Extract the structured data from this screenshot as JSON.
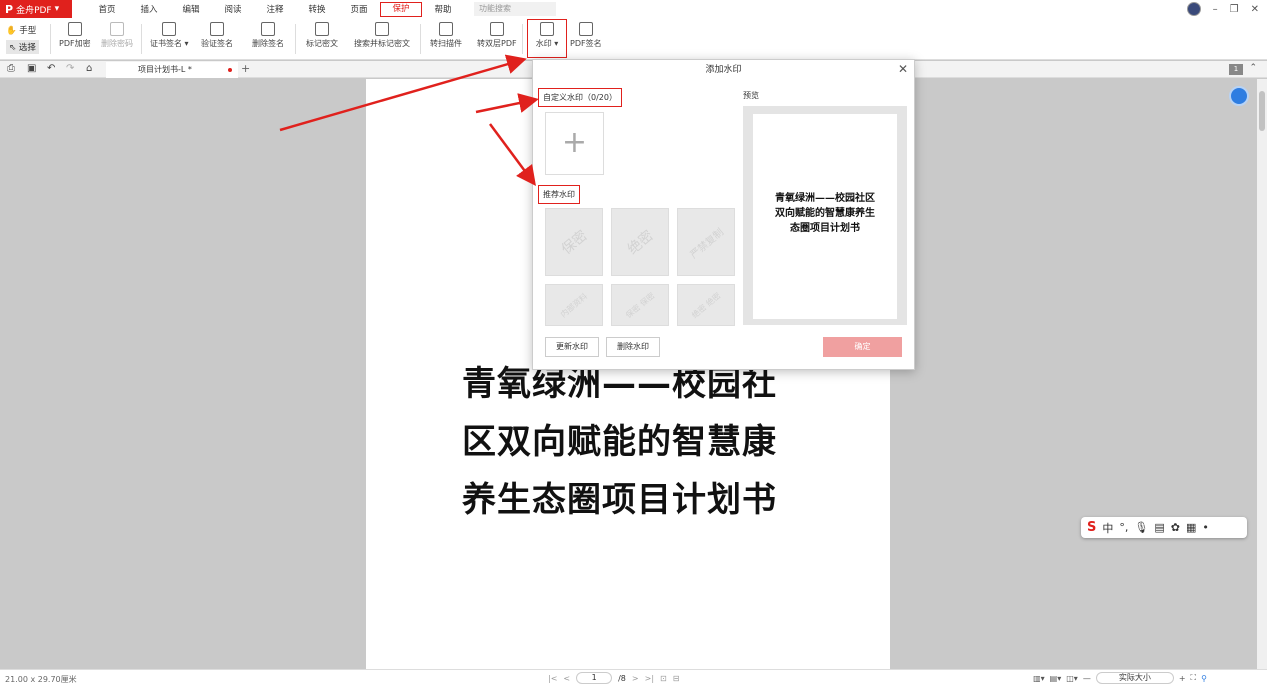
{
  "app": {
    "brand": "金舟PDF",
    "logo_char": "P"
  },
  "menu": [
    {
      "label": "首页",
      "active": false
    },
    {
      "label": "插入",
      "active": false
    },
    {
      "label": "编辑",
      "active": false
    },
    {
      "label": "阅读",
      "active": false
    },
    {
      "label": "注释",
      "active": false
    },
    {
      "label": "转换",
      "active": false
    },
    {
      "label": "页面",
      "active": false
    },
    {
      "label": "保护",
      "active": true
    },
    {
      "label": "帮助",
      "active": false
    }
  ],
  "search": {
    "placeholder": "功能搜索"
  },
  "ribbon": {
    "hand": "手型",
    "select": "选择",
    "tools": [
      {
        "label": "PDF加密",
        "disabled": false,
        "icon": "lock-icon"
      },
      {
        "label": "删除密码",
        "disabled": true,
        "icon": "unlock-icon"
      },
      {
        "label": "证书签名 ▾",
        "disabled": false,
        "icon": "certificate-sign-icon"
      },
      {
        "label": "验证签名",
        "disabled": false,
        "icon": "verify-sign-icon"
      },
      {
        "label": "删除签名",
        "disabled": false,
        "icon": "delete-sign-icon"
      },
      {
        "label": "标记密文",
        "disabled": false,
        "icon": "redact-mark-icon"
      },
      {
        "label": "搜索并标记密文",
        "disabled": false,
        "icon": "search-redact-icon"
      },
      {
        "label": "转扫描件",
        "disabled": false,
        "icon": "scan-icon"
      },
      {
        "label": "转双层PDF",
        "disabled": false,
        "icon": "dual-layer-icon"
      },
      {
        "label": "水印 ▾",
        "disabled": false,
        "icon": "watermark-icon"
      },
      {
        "label": "PDF签名",
        "disabled": false,
        "icon": "pdf-sign-icon"
      }
    ]
  },
  "tab": {
    "title": "项目计划书-L *"
  },
  "page_badge": "1",
  "document": {
    "title_lines": [
      "青氧绿洲——校园社",
      "区双向赋能的智慧康",
      "养生态圈项目计划书"
    ]
  },
  "dialog": {
    "title": "添加水印",
    "custom_label": "自定义水印（0/20）",
    "recommend_label": "推荐水印",
    "watermarks": [
      "保密",
      "绝密",
      "严禁复制",
      "内部资料",
      "保密 保密",
      "绝密 绝密"
    ],
    "update_button": "更新水印",
    "delete_button": "删除水印",
    "confirm_button": "确定",
    "preview_label": "预览",
    "preview_text": "青氧绿洲——校园社区双向赋能的智慧康养生态圈项目计划书"
  },
  "status": {
    "dimensions": "21.00 x 29.70厘米",
    "current_page": "1",
    "total_pages": "/8",
    "zoom": "实际大小"
  },
  "ime": {
    "lang": "中"
  },
  "colors": {
    "brand": "#e0211d",
    "accent": "#2e7de1",
    "confirm": "#f0a0a0"
  }
}
